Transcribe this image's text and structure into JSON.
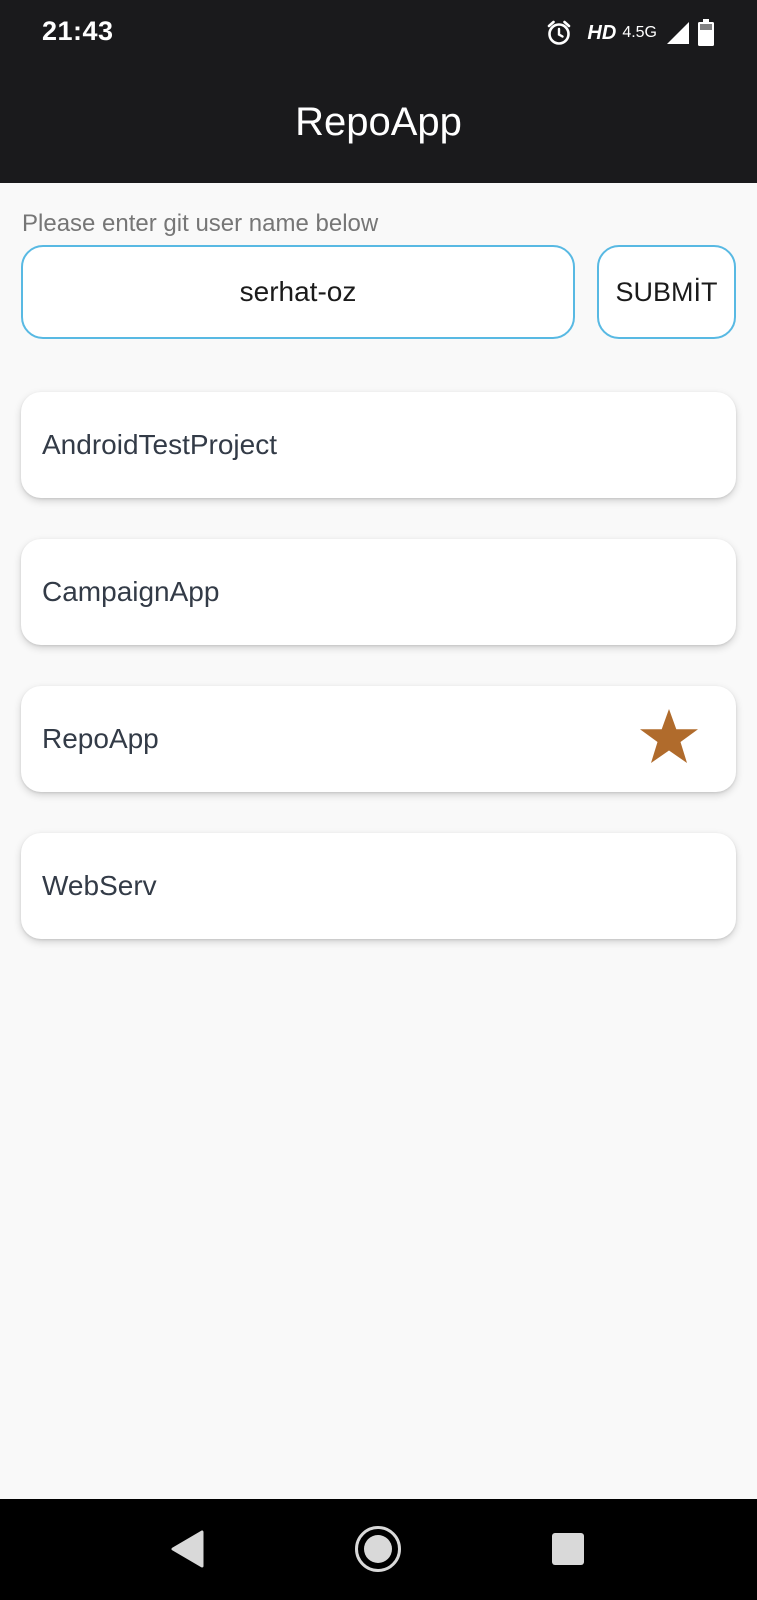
{
  "status_bar": {
    "time": "21:43",
    "hd_label": "HD",
    "network_label": "4.5G",
    "icons": [
      "alarm-icon",
      "signal-icon",
      "battery-icon"
    ]
  },
  "app_bar": {
    "title": "RepoApp",
    "background": "#1a1a1c"
  },
  "search": {
    "hint": "Please enter git user name below",
    "value": "serhat-oz",
    "submit_label": "SUBMİT",
    "accent": "#58b9e3"
  },
  "repos": [
    {
      "name": "AndroidTestProject",
      "favorite": false
    },
    {
      "name": "CampaignApp",
      "favorite": false
    },
    {
      "name": "RepoApp",
      "favorite": true
    },
    {
      "name": "WebServ",
      "favorite": false
    }
  ],
  "colors": {
    "star": "#b06b2c",
    "page_background": "#f9f9f9",
    "card_text": "#333b47"
  },
  "nav_bar": {
    "icons": [
      "back-icon",
      "home-icon",
      "recents-icon"
    ]
  }
}
